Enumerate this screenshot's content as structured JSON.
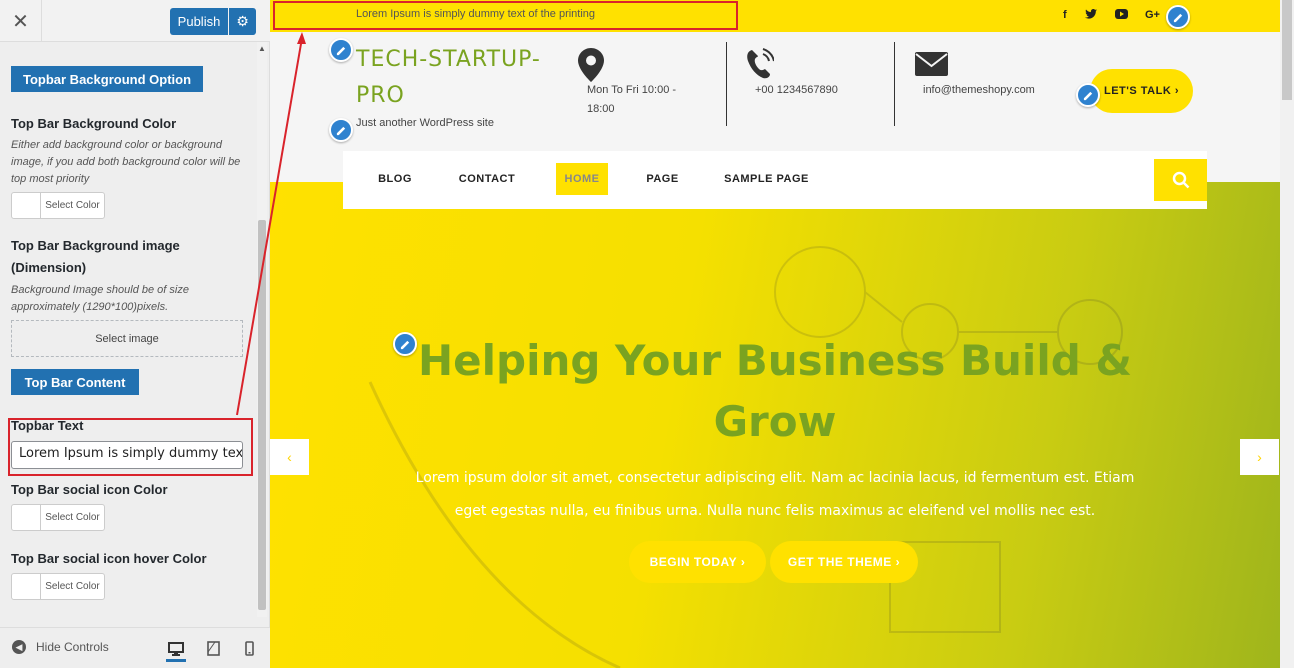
{
  "sidebar": {
    "publish_label": "Publish",
    "sections": {
      "background_option": "Topbar Background Option",
      "bar_content": "Top Bar Content"
    },
    "bg_color": {
      "title": "Top Bar Background Color",
      "desc": "Either add background color or background image, if you add both background color will be top most priority",
      "button": "Select Color"
    },
    "bg_image": {
      "title_line1": "Top Bar Background image",
      "title_line2": "(Dimension)",
      "desc": "Background Image should be of size approximately (1290*100)pixels.",
      "button": "Select image"
    },
    "topbar_text": {
      "title": "Topbar Text",
      "value": "Lorem Ipsum is simply dummy text of"
    },
    "social_color": {
      "title": "Top Bar social icon Color",
      "button": "Select Color"
    },
    "social_hover": {
      "title": "Top Bar social icon hover Color",
      "button": "Select Color"
    },
    "footer": {
      "hide_controls": "Hide Controls"
    }
  },
  "preview": {
    "topbar_text": "Lorem Ipsum is simply dummy text of the printing",
    "social_icons": [
      "f",
      "t",
      "yt",
      "G+"
    ],
    "site_title": "TECH-STARTUP-PRO",
    "tagline": "Just another WordPress site",
    "hours": "Mon To Fri 10:00 - 18:00",
    "phone": "+00 1234567890",
    "email": "info@themeshopy.com",
    "talk_label": "LET'S TALK",
    "nav": [
      "BLOG",
      "CONTACT",
      "HOME",
      "PAGE",
      "SAMPLE PAGE"
    ],
    "hero": {
      "title": "Helping Your Business Build & Grow",
      "body": "Lorem ipsum dolor sit amet, consectetur adipiscing elit. Nam ac lacinia lacus, id fermentum est. Etiam eget egestas nulla, eu finibus urna. Nulla nunc felis maximus ac eleifend vel mollis nec est.",
      "btn1": "BEGIN TODAY",
      "btn2": "GET THE THEME"
    }
  },
  "colors": {
    "accent_yellow": "#ffe100",
    "title_green": "#7aa320",
    "wp_blue": "#2271b1",
    "highlight_red": "#d9232b"
  }
}
